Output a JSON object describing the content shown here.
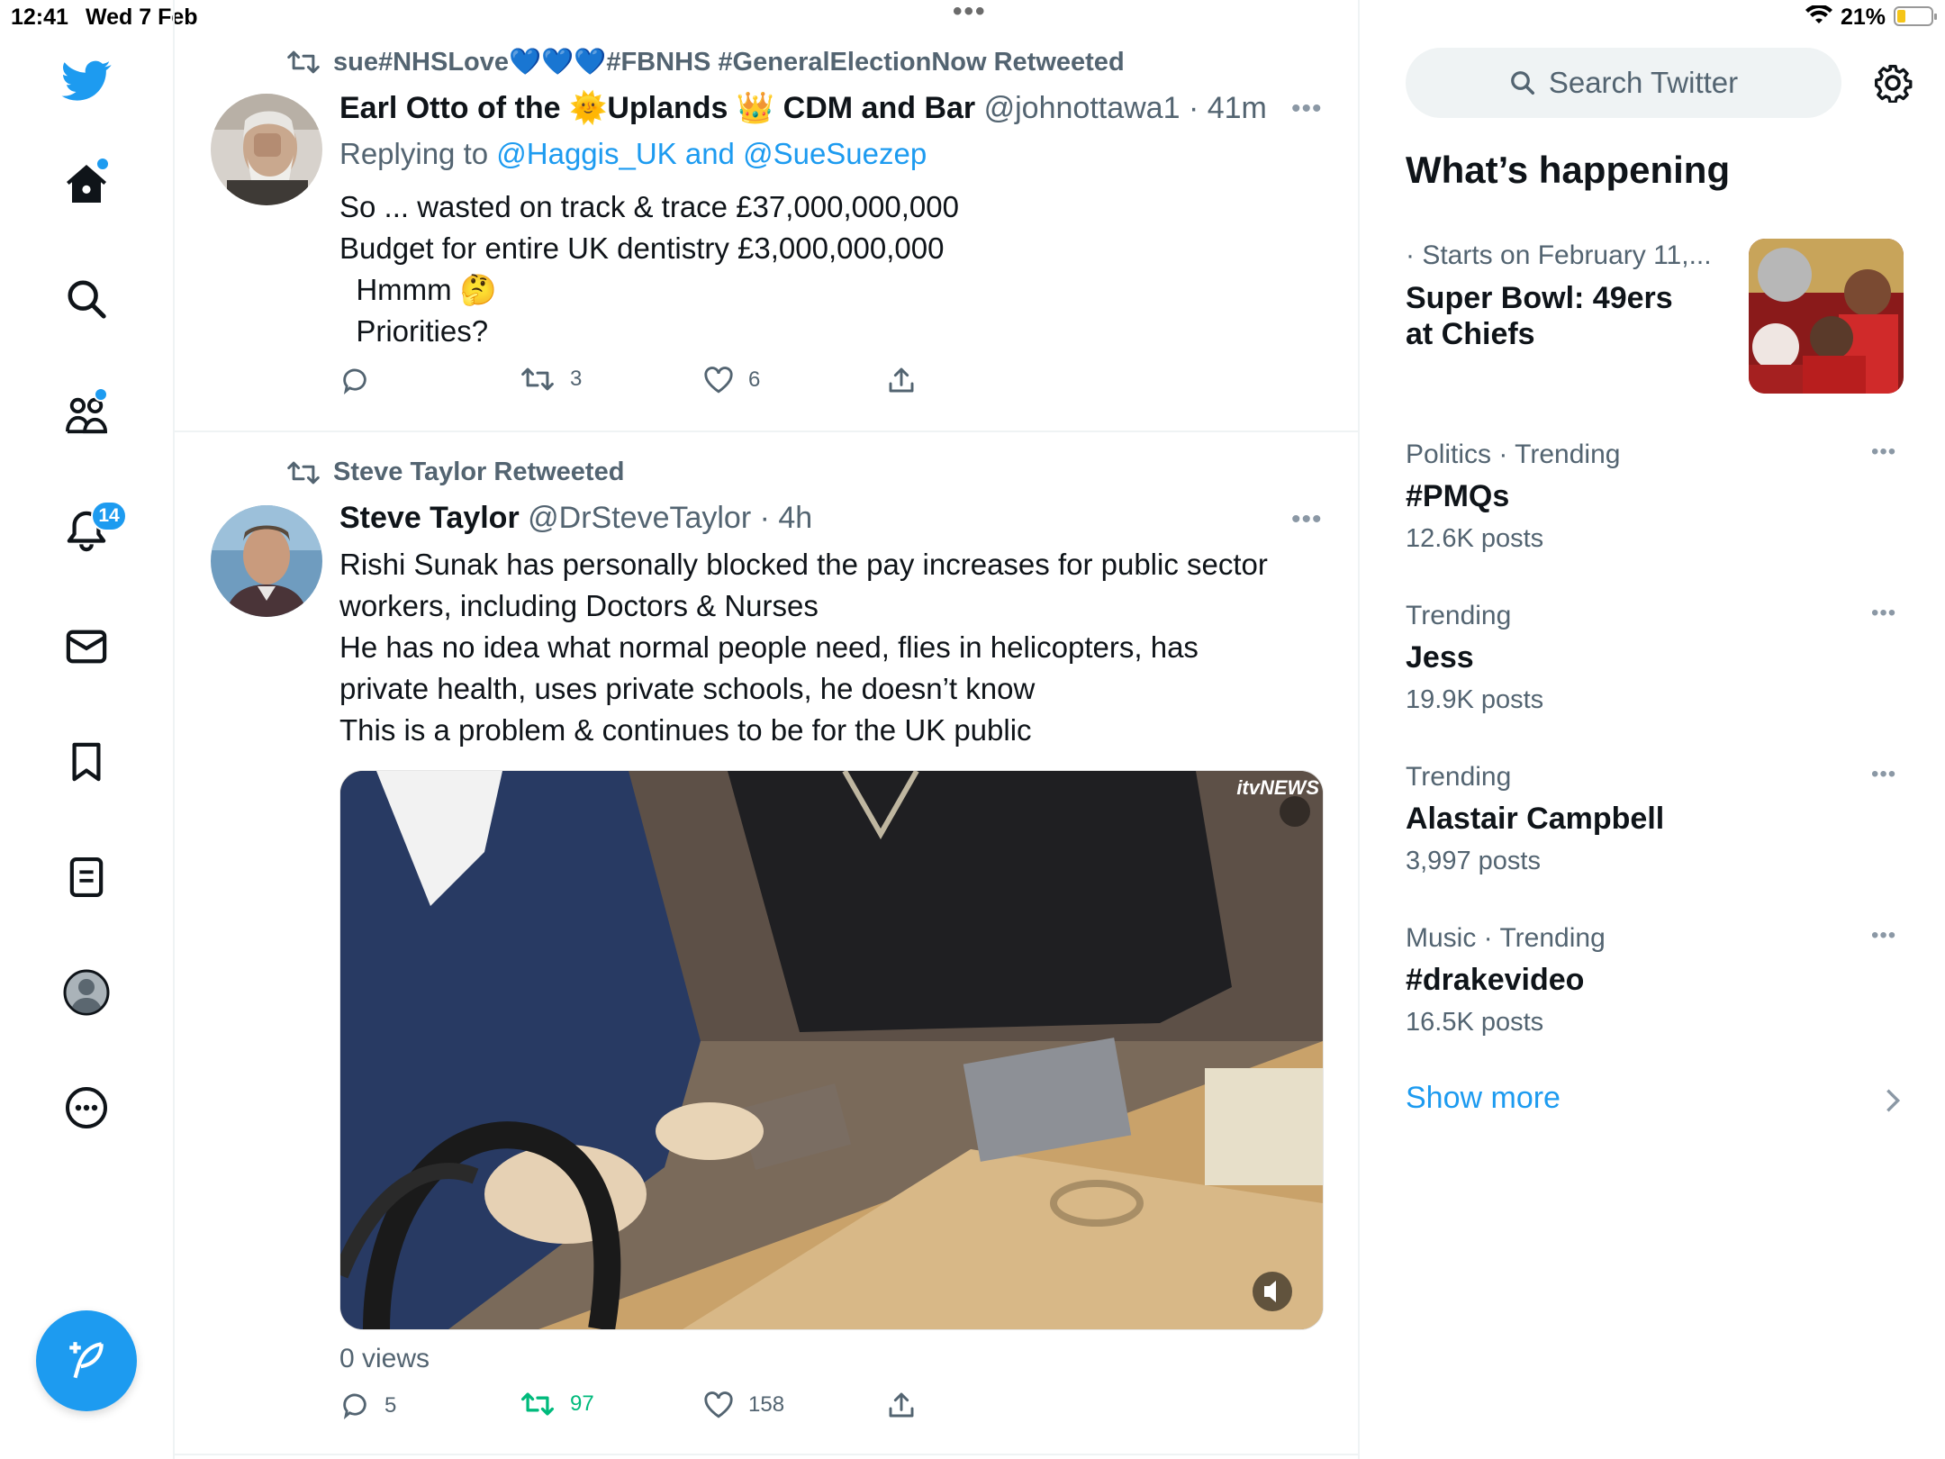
{
  "status_bar": {
    "time": "12:41",
    "date": "Wed 7 Feb",
    "battery": "21%",
    "battery_level": 0.21
  },
  "nav": {
    "notifications_badge": "14"
  },
  "tweets": [
    {
      "retweeted_by": "sue#NHSLove💙💙💙#FBNHS #GeneralElectionNow Retweeted",
      "name": "Earl Otto of the 🌞Uplands 👑 CDM and Bar",
      "handle": "@johnottawa1",
      "time": "· 41m",
      "replying_prefix": "Replying to ",
      "replying_to": "@Haggis_UK and @SueSuezep",
      "text": "So ... wasted on track & trace £37,000,000,000\nBudget for entire UK dentistry £3,000,000,000\n  Hmmm 🤔\n  Priorities?",
      "replies": "",
      "retweets": "3",
      "likes": "6"
    },
    {
      "retweeted_by": "Steve Taylor Retweeted",
      "name": "Steve Taylor",
      "handle": "@DrSteveTaylor",
      "time": "· 4h",
      "text": "Rishi Sunak has personally blocked the pay increases for public sector\nworkers, including Doctors & Nurses\nHe has no idea what normal people need, flies in helicopters, has\nprivate health, uses private schools, he doesn’t know\nThis is a problem & continues to be for the UK public",
      "media_watermark": "itvNEWS",
      "views": "0 views",
      "replies": "5",
      "retweets": "97",
      "likes": "158"
    }
  ],
  "search": {
    "placeholder": "Search Twitter"
  },
  "whats_happening": {
    "title": "What’s happening",
    "featured": {
      "meta": "· Starts on February 11,...",
      "title_line1": "Super Bowl: 49ers",
      "title_line2": "at Chiefs"
    },
    "trends": [
      {
        "meta": "Politics · Trending",
        "name": "#PMQs",
        "count": "12.6K posts"
      },
      {
        "meta": "Trending",
        "name": "Jess",
        "count": "19.9K posts"
      },
      {
        "meta": "Trending",
        "name": "Alastair Campbell",
        "count": "3,997 posts"
      },
      {
        "meta": "Music · Trending",
        "name": "#drakevideo",
        "count": "16.5K posts"
      }
    ],
    "show_more": "Show more"
  },
  "colors": {
    "accent": "#1d9bf0",
    "muted": "#536471",
    "retweet_active": "#00ba7c"
  }
}
